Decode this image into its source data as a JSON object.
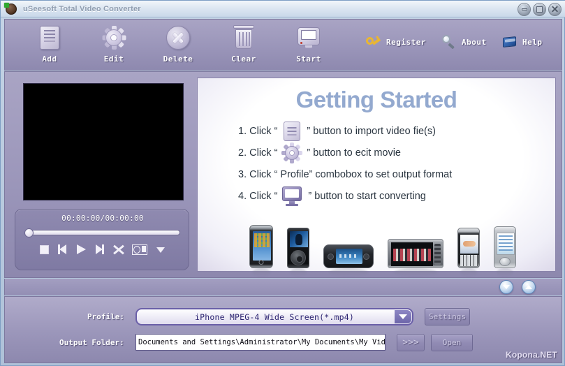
{
  "window": {
    "title": "uSeesoft Total Video Converter",
    "icon": "app-icon",
    "controls": {
      "minimize": "minimize",
      "maximize": "maximize",
      "close": "close"
    }
  },
  "toolbar": {
    "items": [
      {
        "label": "Add",
        "icon": "document-icon"
      },
      {
        "label": "Edit",
        "icon": "gear-icon"
      },
      {
        "label": "Delete",
        "icon": "x-circle-icon"
      },
      {
        "label": "Clear",
        "icon": "trash-icon"
      },
      {
        "label": "Start",
        "icon": "monitor-icon"
      }
    ],
    "links": [
      {
        "label": "Register",
        "icon": "key-icon"
      },
      {
        "label": "About",
        "icon": "magnifier-icon"
      },
      {
        "label": "Help",
        "icon": "book-icon"
      }
    ]
  },
  "player": {
    "time": "00:00:00/00:00:00",
    "seek_position_pct": 0,
    "controls": [
      {
        "name": "stop-button"
      },
      {
        "name": "previous-button"
      },
      {
        "name": "play-button"
      },
      {
        "name": "next-button"
      },
      {
        "name": "fullscreen-button"
      },
      {
        "name": "snapshot-button"
      },
      {
        "name": "more-dropdown-button"
      }
    ]
  },
  "getting_started": {
    "title": "Getting Started",
    "steps": [
      {
        "number": "1. Click “",
        "icon": "document-icon",
        "tail": "” button to import video fie(s)"
      },
      {
        "number": "2. Click “",
        "icon": "gear-icon",
        "tail": "” button to ecit movie"
      },
      {
        "number": "3. Click “ Profile” combobox to set output format",
        "icon": "",
        "tail": ""
      },
      {
        "number": "4. Click “",
        "icon": "monitor-icon",
        "tail": "” button to start converting"
      }
    ],
    "devices": [
      {
        "name": "iphone"
      },
      {
        "name": "ipod"
      },
      {
        "name": "psp"
      },
      {
        "name": "portable-media-player"
      },
      {
        "name": "blackberry-phone"
      },
      {
        "name": "pda"
      }
    ]
  },
  "scroll": {
    "down_label": "scroll-down",
    "up_label": "scroll-up"
  },
  "footer": {
    "profile_label": "Profile:",
    "profile_value": "iPhone MPEG-4 Wide Screen(*.mp4)",
    "settings_label": "Settings",
    "output_label": "Output Folder:",
    "output_value": "Documents and Settings\\Administrator\\My Documents\\My Videos",
    "browse_label": ">>>",
    "open_label": "Open"
  },
  "watermark": "Kopona.NET",
  "colors": {
    "accent_purple": "#6a5fa8",
    "panel_purple": "#9b96ba",
    "title_blue": "#93a9cf",
    "combo_text": "#2b2370"
  }
}
